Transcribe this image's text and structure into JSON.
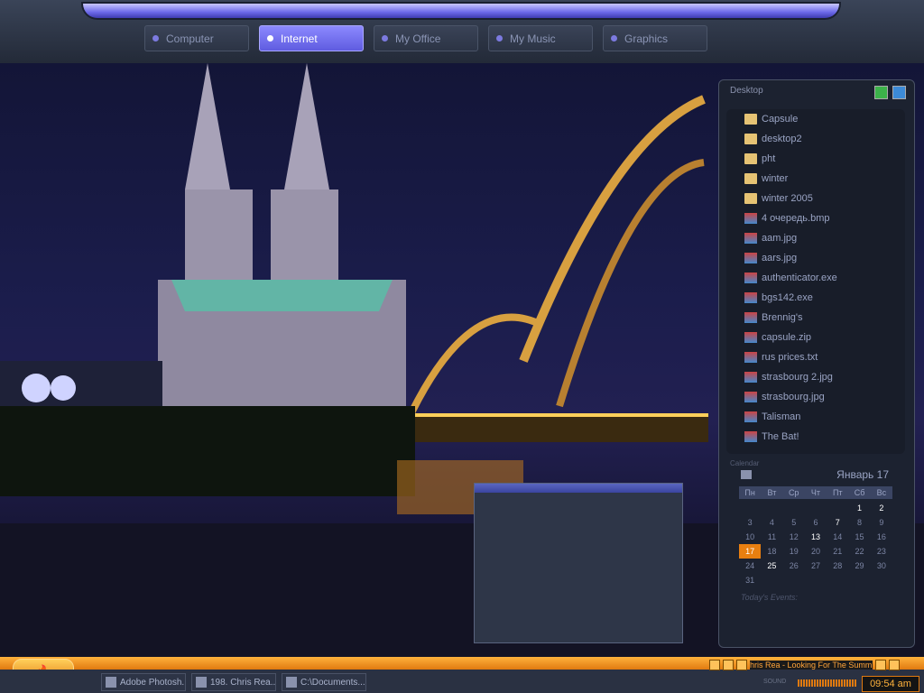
{
  "tabs": [
    {
      "label": "Computer",
      "active": false
    },
    {
      "label": "Internet",
      "active": true
    },
    {
      "label": "My Office",
      "active": false
    },
    {
      "label": "My Music",
      "active": false
    },
    {
      "label": "Graphics",
      "active": false
    }
  ],
  "desktop_panel": {
    "title": "Desktop",
    "files": [
      {
        "name": "Capsule",
        "icon": "folder-icon"
      },
      {
        "name": "desktop2",
        "icon": "folder-icon"
      },
      {
        "name": "pht",
        "icon": "folder-icon"
      },
      {
        "name": "winter",
        "icon": "folder-icon"
      },
      {
        "name": "winter 2005",
        "icon": "folder-icon"
      },
      {
        "name": "4 очередь.bmp",
        "icon": "image-icon"
      },
      {
        "name": "aam.jpg",
        "icon": "image-icon"
      },
      {
        "name": "aars.jpg",
        "icon": "image-icon"
      },
      {
        "name": "authenticator.exe",
        "icon": "exe-icon"
      },
      {
        "name": "bgs142.exe",
        "icon": "disc-icon"
      },
      {
        "name": "Brennig's",
        "icon": "app-icon"
      },
      {
        "name": "capsule.zip",
        "icon": "zip-icon"
      },
      {
        "name": "rus prices.txt",
        "icon": "text-file-icon"
      },
      {
        "name": "strasbourg 2.jpg",
        "icon": "image-icon"
      },
      {
        "name": "strasbourg.jpg",
        "icon": "image-icon"
      },
      {
        "name": "Talisman",
        "icon": "drop-icon"
      },
      {
        "name": "The Bat!",
        "icon": "bat-icon"
      }
    ]
  },
  "calendar": {
    "label": "Calendar",
    "month": "Январь 17",
    "weekdays": [
      "Пн",
      "Вт",
      "Ср",
      "Чт",
      "Пт",
      "Сб",
      "Вс"
    ],
    "weeks": [
      [
        "",
        "",
        "",
        "",
        "",
        "1",
        "2"
      ],
      [
        "3",
        "4",
        "5",
        "6",
        "7",
        "8",
        "9"
      ],
      [
        "10",
        "11",
        "12",
        "13",
        "14",
        "15",
        "16"
      ],
      [
        "17",
        "18",
        "19",
        "20",
        "21",
        "22",
        "23"
      ],
      [
        "24",
        "25",
        "26",
        "27",
        "28",
        "29",
        "30"
      ],
      [
        "31",
        "",
        "",
        "",
        "",
        "",
        ""
      ]
    ],
    "today": "17",
    "events_label": "Today's Events:"
  },
  "taskbar": {
    "tasks": [
      {
        "label": "Adobe Photosh..."
      },
      {
        "label": "198. Chris Rea..."
      },
      {
        "label": "C:\\Documents..."
      }
    ],
    "now_playing": "hris Rea - Looking For The Summ",
    "sound_label": "SOUND",
    "clock": "09:54 am"
  },
  "colors": {
    "accent": "#7c7ae0",
    "orange": "#e07a10",
    "panel": "#1c2230"
  }
}
